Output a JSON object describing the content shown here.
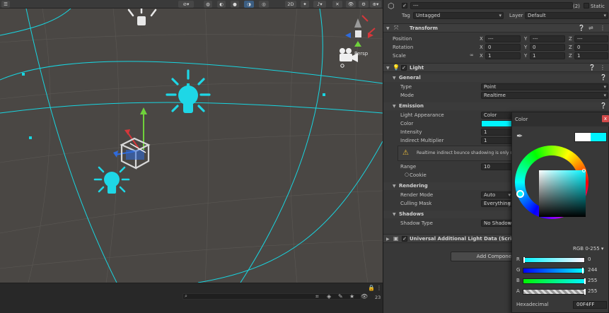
{
  "scene": {
    "toolbar": {
      "mode_2d": "2D",
      "hidden_count_label": "23"
    },
    "persp_label": "Persp"
  },
  "inspector": {
    "object": {
      "name_value": "---",
      "static_count": "(2)",
      "static_label": "Static",
      "tag_label": "Tag",
      "tag_value": "Untagged",
      "layer_label": "Layer",
      "layer_value": "Default"
    },
    "transform": {
      "title": "Transform",
      "rows": [
        {
          "label": "Position",
          "x": "---",
          "y": "---",
          "z": "---"
        },
        {
          "label": "Rotation",
          "x": "0",
          "y": "0",
          "z": "0"
        },
        {
          "label": "Scale",
          "x": "1",
          "y": "1",
          "z": "1"
        }
      ],
      "axis_x": "X",
      "axis_y": "Y",
      "axis_z": "Z"
    },
    "light": {
      "title": "Light",
      "general_header": "General",
      "type_label": "Type",
      "type_value": "Point",
      "mode_label": "Mode",
      "mode_value": "Realtime",
      "emission_header": "Emission",
      "appearance_label": "Light Appearance",
      "appearance_value": "Color",
      "color_label": "Color",
      "intensity_label": "Intensity",
      "intensity_value": "1",
      "indirect_label": "Indirect Multiplier",
      "indirect_value": "1",
      "warning_text": "Realtime indirect bounce shadowing is only su",
      "range_label": "Range",
      "range_value": "10",
      "cookie_label": "Cookie",
      "rendering_header": "Rendering",
      "render_mode_label": "Render Mode",
      "render_mode_value": "Auto",
      "culling_label": "Culling Mask",
      "culling_value": "Everything",
      "shadows_header": "Shadows",
      "shadow_type_label": "Shadow Type",
      "shadow_type_value": "No Shadows"
    },
    "urp_component_title": "Universal Additional Light Data (Script)",
    "add_component_label": "Add Component"
  },
  "color_picker": {
    "title": "Color",
    "close_label": "x",
    "mode_label": "RGB 0-255 ▾",
    "channels": [
      {
        "name": "R",
        "value": "0"
      },
      {
        "name": "G",
        "value": "244"
      },
      {
        "name": "B",
        "value": "255"
      },
      {
        "name": "A",
        "value": "255"
      }
    ],
    "hex_label": "Hexadecimal",
    "hex_value": "00F4FF",
    "color": "#00F4FF"
  },
  "colors": {
    "accent_cyan": "#00F4FF",
    "inspector_bg": "#383838",
    "scene_bg": "#4A4744"
  }
}
